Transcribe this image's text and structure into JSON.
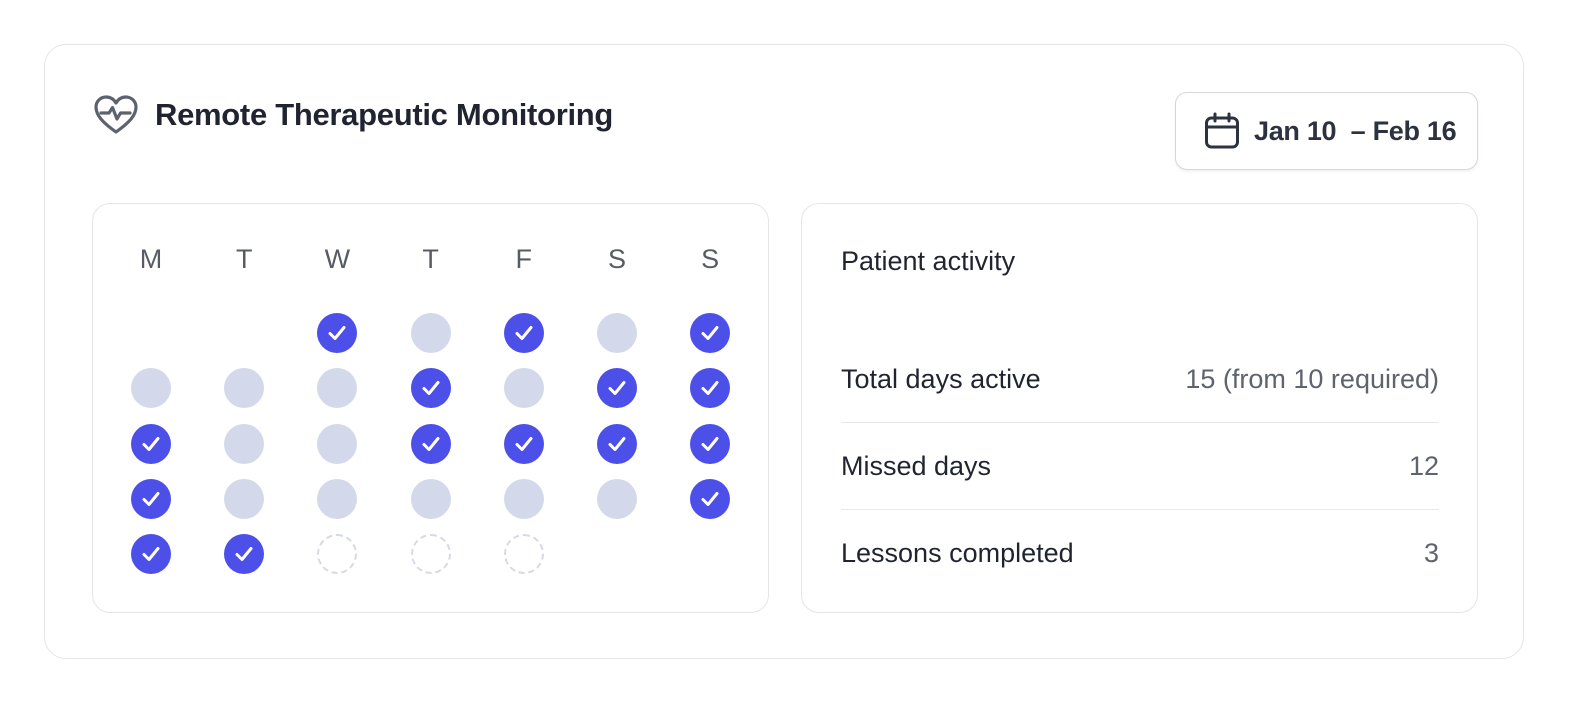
{
  "widget": {
    "title": "Remote Therapeutic Monitoring",
    "title_icon": "heart-pulse-icon",
    "date_range": {
      "icon": "calendar-icon",
      "label": "Jan 10  – Feb 16"
    }
  },
  "calendar": {
    "weekdays": [
      "M",
      "T",
      "W",
      "T",
      "F",
      "S",
      "S"
    ],
    "weeks": [
      [
        null,
        null,
        "active",
        "missed",
        "active",
        "missed",
        "active"
      ],
      [
        "missed",
        "missed",
        "missed",
        "active",
        "missed",
        "active",
        "active"
      ],
      [
        "active",
        "missed",
        "missed",
        "active",
        "active",
        "active",
        "active"
      ],
      [
        "active",
        "missed",
        "missed",
        "missed",
        "missed",
        "missed",
        "active"
      ],
      [
        "active",
        "active",
        "future",
        "future",
        "future",
        null,
        null
      ]
    ],
    "colors": {
      "active": "#4c4fe8",
      "missed": "#d3d9ea",
      "future_border": "#d6dae6"
    }
  },
  "activity": {
    "title": "Patient activity",
    "rows": [
      {
        "label": "Total days active",
        "value": "15 (from 10 required)"
      },
      {
        "label": "Missed days",
        "value": "12"
      },
      {
        "label": "Lessons completed",
        "value": "3"
      }
    ]
  }
}
